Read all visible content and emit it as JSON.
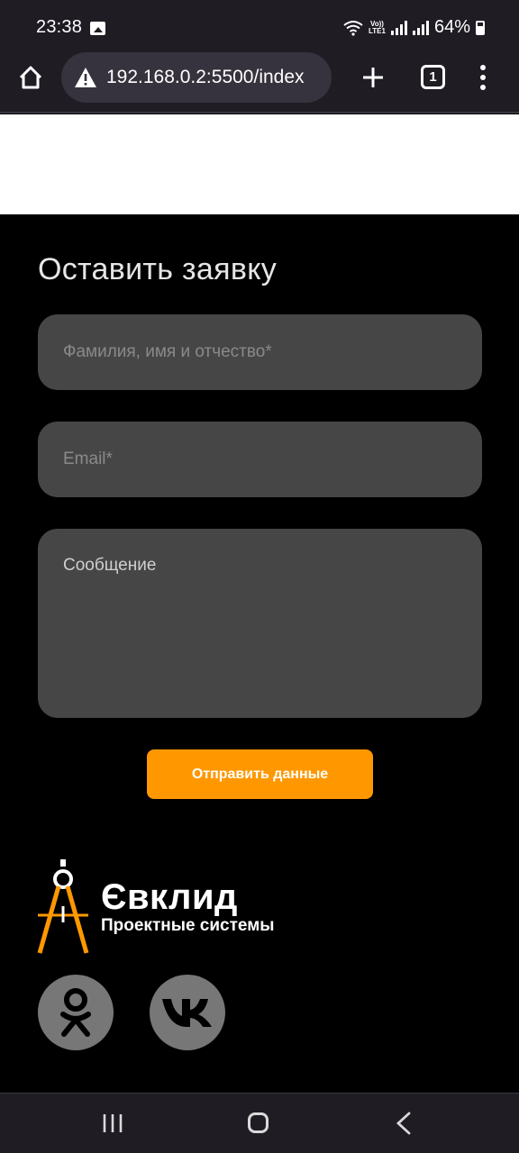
{
  "status_bar": {
    "time": "23:38",
    "lte_top": "Vo))",
    "lte_bottom": "LTE1",
    "battery": "64%",
    "icons": [
      "photo-icon",
      "wifi-icon",
      "lte-icon",
      "signal-icon",
      "signal-icon",
      "battery-icon"
    ]
  },
  "browser": {
    "url": "192.168.0.2:5500/index",
    "tab_count": "1",
    "icons": [
      "home-icon",
      "warning-icon",
      "plus-icon",
      "tabs-icon",
      "menu-icon"
    ]
  },
  "form": {
    "title": "Оставить заявку",
    "name_placeholder": "Фамилия, имя и отчество*",
    "email_placeholder": "Email*",
    "message_placeholder": "Сообщение",
    "submit_label": "Отправить данные"
  },
  "logo": {
    "name": "Євклид",
    "subtitle": "Проектные системы",
    "accent_color": "#ff9800"
  },
  "social": {
    "items": [
      "odnoklassniki-icon",
      "vk-icon"
    ],
    "color": "#777777"
  },
  "nav": {
    "icons": [
      "recents-icon",
      "home-icon",
      "back-icon"
    ]
  },
  "colors": {
    "background": "#000000",
    "field": "#464646",
    "button": "#ff9800",
    "browser_chrome": "#1f1c24"
  }
}
